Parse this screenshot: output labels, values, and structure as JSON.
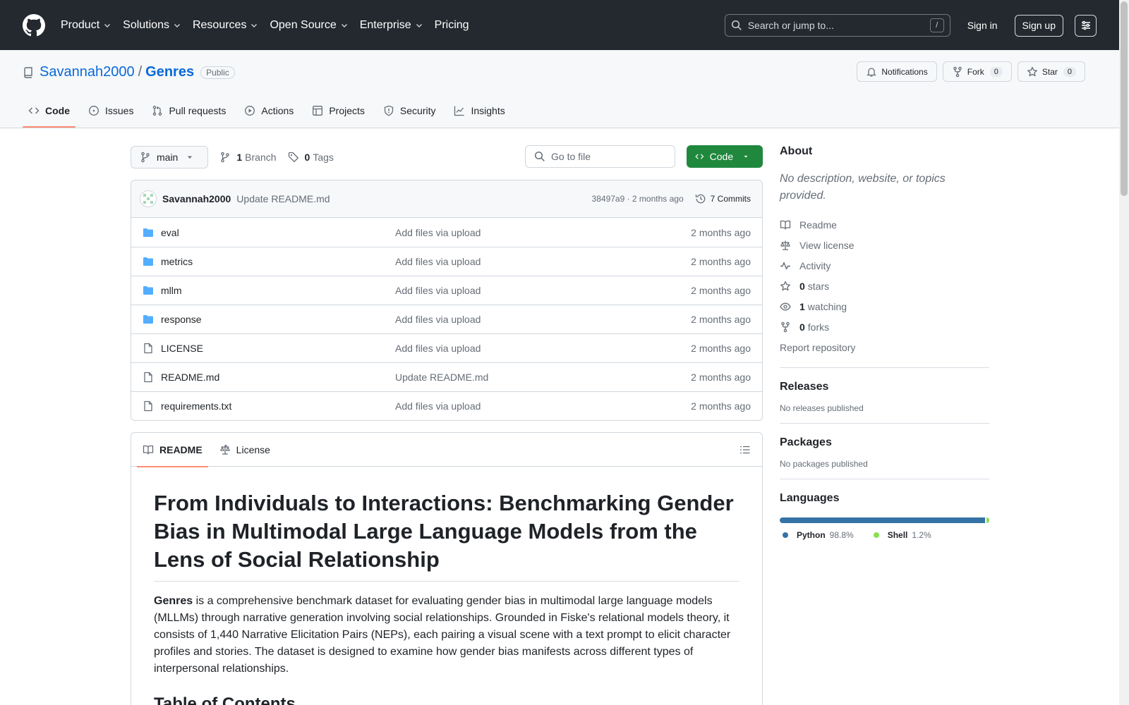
{
  "header": {
    "nav": [
      "Product",
      "Solutions",
      "Resources",
      "Open Source",
      "Enterprise",
      "Pricing"
    ],
    "search_placeholder": "Search or jump to...",
    "search_key": "/",
    "sign_in": "Sign in",
    "sign_up": "Sign up"
  },
  "repo": {
    "owner": "Savannah2000",
    "separator": "/",
    "name": "Genres",
    "visibility": "Public",
    "notifications_label": "Notifications",
    "fork_label": "Fork",
    "fork_count": "0",
    "star_label": "Star",
    "star_count": "0",
    "tabs": [
      "Code",
      "Issues",
      "Pull requests",
      "Actions",
      "Projects",
      "Security",
      "Insights"
    ]
  },
  "toolbar": {
    "branch": "main",
    "branch_count": "1",
    "branch_label": "Branch",
    "tag_count": "0",
    "tag_label": "Tags",
    "go_to_file": "Go to file",
    "code_button": "Code"
  },
  "latest_commit": {
    "author": "Savannah2000",
    "message": "Update README.md",
    "meta": "38497a9 · 2 months ago",
    "commits_label": "7 Commits"
  },
  "files": [
    {
      "name": "eval",
      "type": "folder",
      "commit": "Add files via upload",
      "date": "2 months ago"
    },
    {
      "name": "metrics",
      "type": "folder",
      "commit": "Add files via upload",
      "date": "2 months ago"
    },
    {
      "name": "mllm",
      "type": "folder",
      "commit": "Add files via upload",
      "date": "2 months ago"
    },
    {
      "name": "response",
      "type": "folder",
      "commit": "Add files via upload",
      "date": "2 months ago"
    },
    {
      "name": "LICENSE",
      "type": "file",
      "commit": "Add files via upload",
      "date": "2 months ago"
    },
    {
      "name": "README.md",
      "type": "file",
      "commit": "Update README.md",
      "date": "2 months ago"
    },
    {
      "name": "requirements.txt",
      "type": "file",
      "commit": "Add files via upload",
      "date": "2 months ago"
    }
  ],
  "readme": {
    "tab_readme": "README",
    "tab_license": "License",
    "title": "From Individuals to Interactions: Benchmarking Gender Bias in Multimodal Large Language Models from the Lens of Social Relationship",
    "intro_bold": "Genres",
    "intro_rest": " is a comprehensive benchmark dataset for evaluating gender bias in multimodal large language models (MLLMs) through narrative generation involving social relationships. Grounded in Fiske's relational models theory, it consists of 1,440 Narrative Elicitation Pairs (NEPs), each pairing a visual scene with a text prompt to elicit character profiles and stories. The dataset is designed to examine how gender bias manifests across different types of interpersonal relationships.",
    "next_heading": "Table of Contents"
  },
  "sidebar": {
    "about_title": "About",
    "about_desc": "No description, website, or topics provided.",
    "links": {
      "readme": "Readme",
      "license": "View license",
      "activity": "Activity",
      "stars_count": "0",
      "stars_label": "stars",
      "watching_count": "1",
      "watching_label": "watching",
      "forks_count": "0",
      "forks_label": "forks"
    },
    "report": "Report repository",
    "releases_title": "Releases",
    "releases_text": "No releases published",
    "packages_title": "Packages",
    "packages_text": "No packages published",
    "languages_title": "Languages",
    "languages": [
      {
        "name": "Python",
        "percent": "98.8%",
        "value": 98.8,
        "color": "#3572A5"
      },
      {
        "name": "Shell",
        "percent": "1.2%",
        "value": 1.2,
        "color": "#89e051"
      }
    ]
  },
  "colors": {
    "header_bg": "#24292f",
    "link": "#0969da",
    "primary_button": "#1f883d",
    "active_tab_underline": "#fd8c73",
    "folder_icon": "#54aeff"
  }
}
